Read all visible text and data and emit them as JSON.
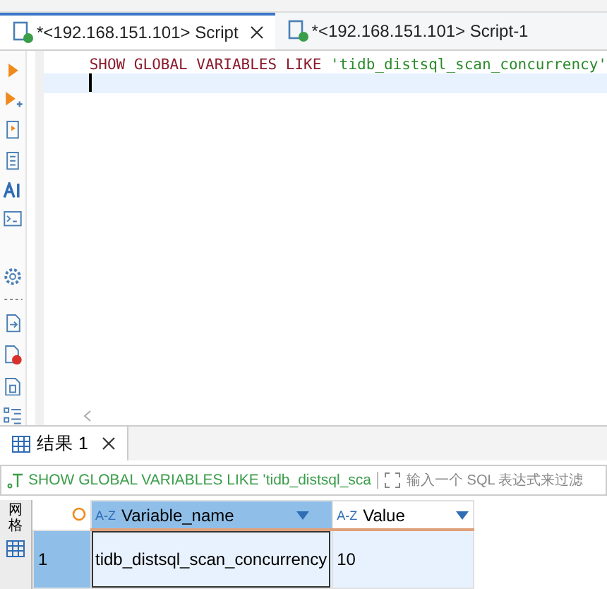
{
  "editor_tabs": [
    {
      "label": "*<192.168.151.101> Script",
      "selected": true,
      "closable": true
    },
    {
      "label": "*<192.168.151.101> Script-1",
      "selected": false,
      "closable": false
    }
  ],
  "editor": {
    "keywords": "SHOW GLOBAL VARIABLES LIKE",
    "string": "'tidb_distsql_scan_concurrency'"
  },
  "result_tabs": [
    {
      "label": "结果 1",
      "selected": true
    }
  ],
  "filter_bar": {
    "query": "SHOW GLOBAL VARIABLES LIKE 'tidb_distsql_sca",
    "placeholder": "输入一个 SQL 表达式来过滤"
  },
  "side_tab": {
    "label": "网格"
  },
  "table": {
    "columns": [
      {
        "name": "Variable_name",
        "type_badge": "A-Z"
      },
      {
        "name": "Value",
        "type_badge": "A-Z"
      }
    ],
    "rows": [
      {
        "number": "1",
        "cells": [
          "tidb_distsql_scan_concurrency",
          "10"
        ],
        "selected": true
      }
    ]
  }
}
